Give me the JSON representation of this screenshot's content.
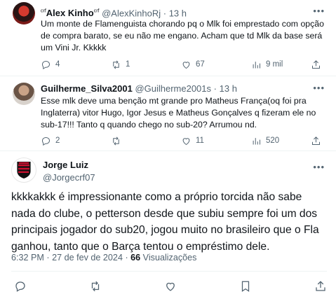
{
  "replies": [
    {
      "name": "Alex Kinho",
      "name_prefix": "crf",
      "name_suffix": "crf",
      "handle": "@AlexKinhoRj",
      "time": "13 h",
      "text": "Um monte de Flamenguista chorando pq o Mlk foi emprestado com opção de compra barato, se eu não me engano. Acham que td Mlk da base será um Vini Jr. Kkkkk",
      "replies": "4",
      "retweets": "1",
      "likes": "67",
      "views": "9 mil"
    },
    {
      "name": "Guilherme_Silva2001",
      "handle": "@Guilherme2001s",
      "time": "13 h",
      "text": "Esse mlk deve uma benção mt grande pro Matheus França(oq foi pra Inglaterra) vitor Hugo, Igor Jesus e Matheus Gonçalves q fizeram ele no sub-17!!! Tanto q quando chego no sub-20? Arrumou nd.",
      "replies": "2",
      "retweets": "",
      "likes": "11",
      "views": "520"
    }
  ],
  "main_tweet": {
    "name": "Jorge Luiz",
    "handle": "@Jorgecrf07",
    "text": "kkkkakkk é impressionante como a próprio torcida não sabe nada do clube, o petterson desde que subiu sempre foi um dos principais jogador do sub20, jogou muito no brasileiro que o Fla ganhou, tanto que o Barça tentou o empréstimo dele.",
    "time": "6:32 PM",
    "date": "27 de fev de 2024",
    "views_count": "66",
    "views_label": "Visualizações"
  },
  "icons": {
    "more": "more-icon",
    "reply": "reply-icon",
    "retweet": "retweet-icon",
    "like": "heart-icon",
    "views": "views-icon",
    "bookmark": "bookmark-icon",
    "share": "share-icon"
  },
  "colors": {
    "text": "#0f1419",
    "secondary": "#536471",
    "separator": "#eff3f4",
    "crest_red": "#c8102e",
    "crest_black": "#111111"
  }
}
